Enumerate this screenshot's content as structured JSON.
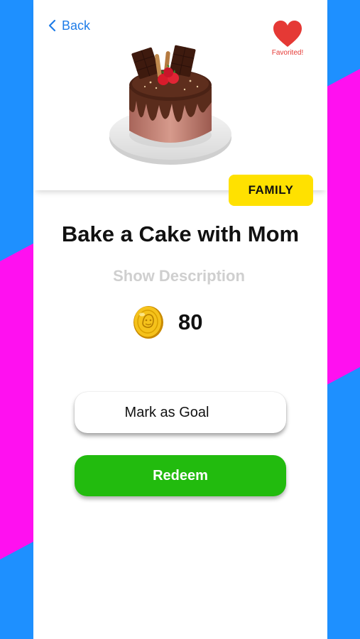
{
  "header": {
    "back_label": "Back",
    "favorite_label": "Favorited!"
  },
  "reward": {
    "category": "FAMILY",
    "title": "Bake a Cake with Mom",
    "show_description_label": "Show Description",
    "points": "80"
  },
  "actions": {
    "goal_label": "Mark as Goal",
    "redeem_label": "Redeem"
  },
  "colors": {
    "accent_blue": "#1e7ce8",
    "heart_red": "#e53935",
    "tag_yellow": "#ffe100",
    "redeem_green": "#22bb0e",
    "background_blue": "#1e90ff",
    "background_magenta": "#ff10f0"
  },
  "icons": {
    "back": "chevron-left-icon",
    "favorite": "heart-icon",
    "points": "coin-icon"
  }
}
